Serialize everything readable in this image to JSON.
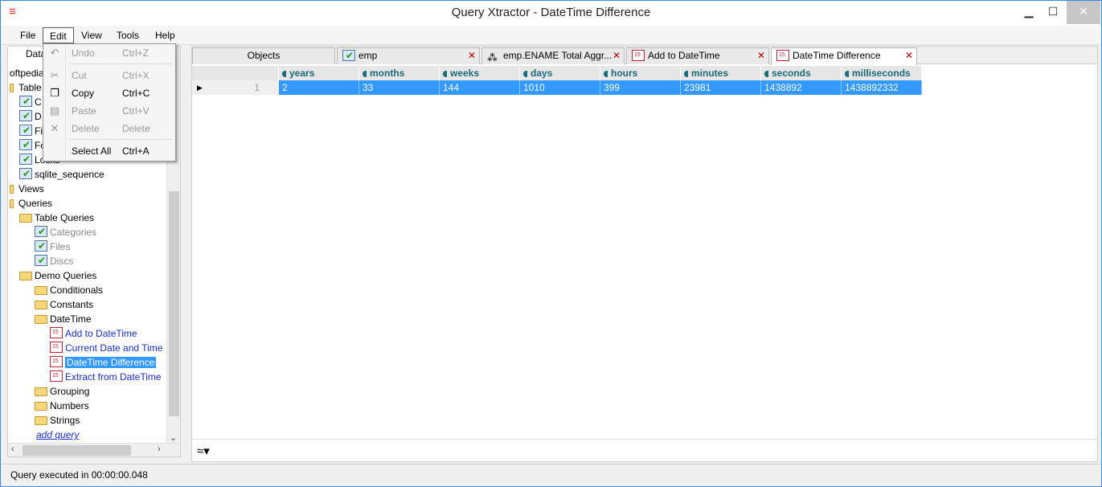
{
  "window": {
    "title": "Query Xtractor - DateTime Difference",
    "minimize": "▁",
    "maximize": "☐",
    "close": "✕"
  },
  "menu": [
    "File",
    "Edit",
    "View",
    "Tools",
    "Help"
  ],
  "edit_menu": {
    "items": [
      {
        "label": "Undo",
        "shortcut": "Ctrl+Z",
        "enabled": false,
        "icon": "undo-icon"
      },
      {
        "label": "Cut",
        "shortcut": "Ctrl+X",
        "enabled": false,
        "icon": "cut-icon"
      },
      {
        "label": "Copy",
        "shortcut": "Ctrl+C",
        "enabled": true,
        "icon": "copy-icon"
      },
      {
        "label": "Paste",
        "shortcut": "Ctrl+V",
        "enabled": false,
        "icon": "paste-icon"
      },
      {
        "label": "Delete",
        "shortcut": "Delete",
        "enabled": false,
        "icon": "delete-icon"
      },
      {
        "label": "Select All",
        "shortcut": "Ctrl+A",
        "enabled": true,
        "icon": ""
      }
    ]
  },
  "left_panel": {
    "tab_label": "Data",
    "tree": [
      {
        "label": "oftpedia",
        "type": "root"
      },
      {
        "label": "Table",
        "type": "group"
      },
      {
        "label": "C",
        "type": "table"
      },
      {
        "label": "D",
        "type": "table"
      },
      {
        "label": "Fi",
        "type": "table"
      },
      {
        "label": "Fo",
        "type": "table"
      },
      {
        "label": "Locks",
        "type": "table"
      },
      {
        "label": "sqlite_sequence",
        "type": "table"
      },
      {
        "label": "Views",
        "type": "group"
      },
      {
        "label": "Queries",
        "type": "group"
      },
      {
        "label": "Table Queries",
        "type": "folder"
      },
      {
        "label": "Categories",
        "type": "table-query"
      },
      {
        "label": "Files",
        "type": "table-query"
      },
      {
        "label": "Discs",
        "type": "table-query"
      },
      {
        "label": "Demo Queries",
        "type": "folder"
      },
      {
        "label": "Conditionals",
        "type": "folder"
      },
      {
        "label": "Constants",
        "type": "folder"
      },
      {
        "label": "DateTime",
        "type": "folder"
      },
      {
        "label": "Add to DateTime",
        "type": "query"
      },
      {
        "label": "Current Date and Time",
        "type": "query"
      },
      {
        "label": "DateTime Difference",
        "type": "query-selected"
      },
      {
        "label": "Extract from DateTime",
        "type": "query"
      },
      {
        "label": "Grouping",
        "type": "folder"
      },
      {
        "label": "Numbers",
        "type": "folder"
      },
      {
        "label": "Strings",
        "type": "folder"
      },
      {
        "label": "add query",
        "type": "link"
      }
    ]
  },
  "tabs": [
    {
      "label": "Objects",
      "icon": "",
      "closable": false
    },
    {
      "label": "emp",
      "icon": "table-icon",
      "closable": true
    },
    {
      "label": "emp.ENAME Total Aggr...",
      "icon": "aggregate-icon",
      "closable": true
    },
    {
      "label": "Add to DateTime",
      "icon": "calendar-icon",
      "closable": true
    },
    {
      "label": "DateTime Difference",
      "icon": "calendar-icon",
      "closable": true
    }
  ],
  "grid": {
    "columns": [
      "years",
      "months",
      "weeks",
      "days",
      "hours",
      "minutes",
      "seconds",
      "milliseconds"
    ],
    "rows": [
      {
        "num": "1",
        "values": [
          "2",
          "33",
          "144",
          "1010",
          "399",
          "23981",
          "1438892",
          "1438892332"
        ]
      }
    ]
  },
  "status": {
    "text": "Query executed in 00:00:00.048"
  },
  "colors": {
    "selection": "#3399ff",
    "header_text": "#1a6a7a",
    "link": "#1a2fc6"
  }
}
